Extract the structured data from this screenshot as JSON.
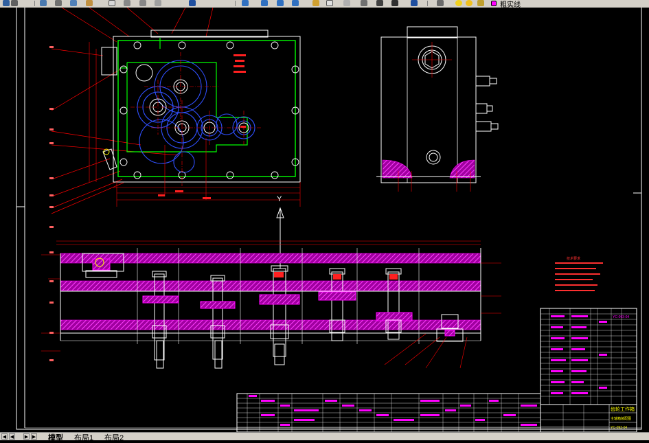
{
  "toolbar": {
    "layer_name": "粗实线",
    "layer_color": "#ff00ff",
    "icons": [
      "save-icon",
      "print-icon",
      "preview-icon",
      "cut-icon",
      "copy-icon",
      "paste-icon",
      "match-icon",
      "undo-icon",
      "redo-icon",
      "pan-icon",
      "zoom-realtime-icon",
      "zoom-window-icon",
      "zoom-previous-icon",
      "properties-icon",
      "design-center-icon",
      "tool-palette-icon",
      "calculator-icon",
      "help-icon"
    ]
  },
  "drawing": {
    "view_label": "Y",
    "top_drawing_no": "YC-093-04",
    "block_title": "齿轮工作箱",
    "drawing_name": "主轴箱装配图",
    "drawing_no": "YC-093-04",
    "tech_title": "技术要求",
    "tech_lines": [
      "1.装配前所有零件清洗干净，箱体内不允许有任何杂物存在。",
      "2.各配合处应涂润滑油。",
      "3.装配后各轴转动灵活无卡滞现象。",
      "4.减速器内装润滑油至规定高度。",
      "5.箱体表面涂灰色油漆。",
      "6.运转试验时不得有冲击和噪声。"
    ],
    "part_numbers": [
      "1",
      "2",
      "3",
      "4",
      "5",
      "6",
      "7",
      "8",
      "9",
      "10",
      "11",
      "12",
      "13",
      "14",
      "15",
      "16",
      "17",
      "18"
    ],
    "colors": {
      "outline": "#ffffff",
      "body": "#00ff00",
      "gear": "#0000ff",
      "dim": "#ff0000",
      "hatch": "#ff00ff",
      "center": "#ff0000",
      "text": "#ffff00"
    }
  },
  "tabs": {
    "model": "模型",
    "layout1": "布局1",
    "layout2": "布局2"
  }
}
